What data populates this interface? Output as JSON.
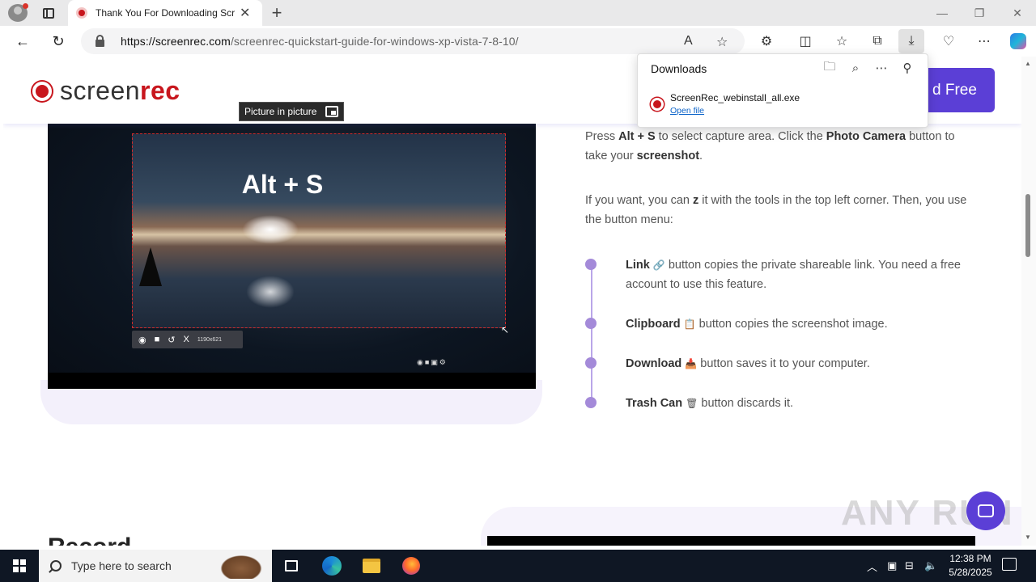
{
  "browser": {
    "tab_title": "Thank You For Downloading ScreenRec",
    "url_domain": "https://screenrec.com",
    "url_path": "/screenrec-quickstart-guide-for-windows-xp-vista-7-8-10/",
    "new_tab": "+",
    "close_tab": "✕",
    "minimize": "—",
    "restore": "❐",
    "close": "✕"
  },
  "page": {
    "logo_prefix": "screen",
    "logo_suffix": "rec",
    "download_free_label": "d Free",
    "pip_label": "Picture in picture",
    "video_overlay_text": "Alt + S",
    "capture_size": "1190x621",
    "para1_pre": "Press ",
    "para1_key": "Alt + S",
    "para1_mid": " to select capture area. Click the ",
    "para1_button": "Photo Camera",
    "para1_post": " button to take your ",
    "para1_end": "screenshot",
    "para1_dot": ".",
    "para2_pre": "If you want, you can ",
    "para2_key": "z",
    "para2_post": " it with the tools in the top left corner. Then, you use the button menu:",
    "items": [
      {
        "name": "Link",
        "icon": "🔗",
        "text": " button copies the private shareable link. You need a free account to use this feature."
      },
      {
        "name": "Clipboard",
        "icon": "📋",
        "text": " button copies the screenshot image."
      },
      {
        "name": "Download",
        "icon": "📥",
        "text": " button saves it to your computer."
      },
      {
        "name": "Trash Can",
        "icon": "🗑",
        "text": " button discards it."
      }
    ],
    "bottom_heading": "Record",
    "watermark": "ANY RUN"
  },
  "downloads": {
    "title": "Downloads",
    "file_name": "ScreenRec_webinstall_all.exe",
    "open_file": "Open file"
  },
  "taskbar": {
    "search_placeholder": "Type here to search",
    "time": "12:38 PM",
    "date": "5/28/2025"
  },
  "colors": {
    "brand_red": "#c8161d",
    "brand_purple": "#5b3fd6",
    "timeline_purple": "#a48ad9"
  }
}
